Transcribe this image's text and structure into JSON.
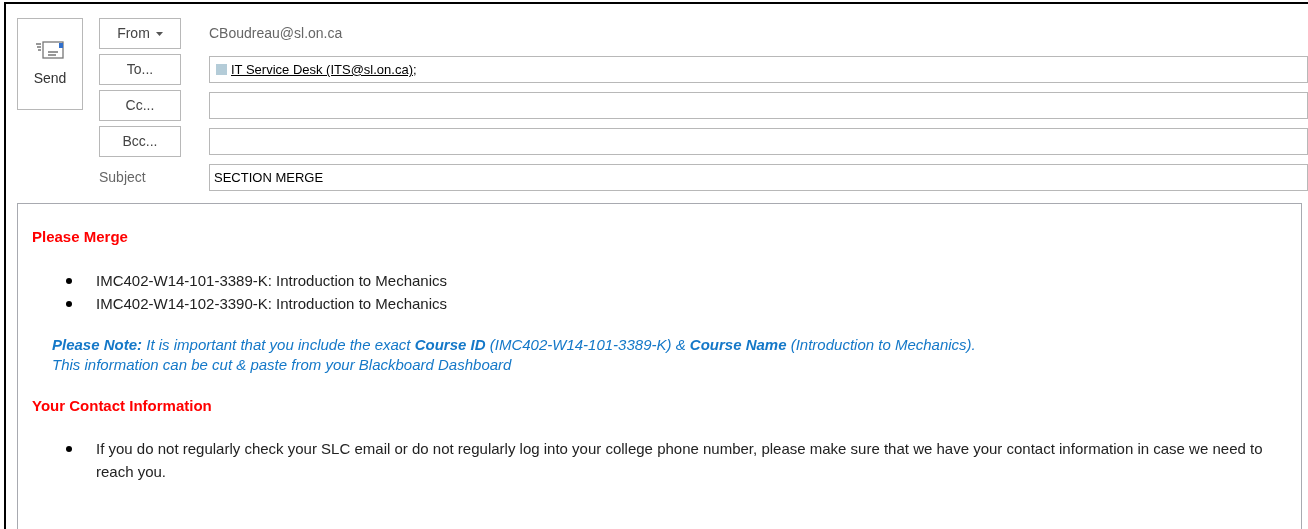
{
  "send_button": {
    "label": "Send"
  },
  "header_fields": [
    {
      "kind": "from",
      "button": "From",
      "value": "CBoudreau@sl.on.ca"
    },
    {
      "kind": "recipient",
      "button": "To...",
      "recipients": [
        "IT Service Desk (ITS@sl.on.ca);"
      ]
    },
    {
      "kind": "recipient",
      "button": "Cc..."
    },
    {
      "kind": "recipient",
      "button": "Bcc..."
    },
    {
      "kind": "subject",
      "label": "Subject",
      "value": "SECTION MERGE"
    }
  ],
  "body": [
    {
      "kind": "heading",
      "text": "Please Merge"
    },
    {
      "kind": "bullets",
      "items": [
        "IMC402-W14-101-3389-K: Introduction to Mechanics",
        "IMC402-W14-102-3390-K: Introduction to Mechanics"
      ]
    },
    {
      "kind": "note",
      "lines": [
        "**Please Note:** It is important that you include the exact **Course ID** (IMC402-W14-101-3389-K) & **Course Name** (Introduction to Mechanics).",
        "This information can be cut & paste from your Blackboard Dashboard"
      ]
    },
    {
      "kind": "heading",
      "text": "Your Contact Information"
    },
    {
      "kind": "bullets",
      "items": [
        "If you do not regularly check your SLC email or do not regularly log into your college phone number, please make sure that we have your contact information in case we need to reach you."
      ]
    }
  ]
}
